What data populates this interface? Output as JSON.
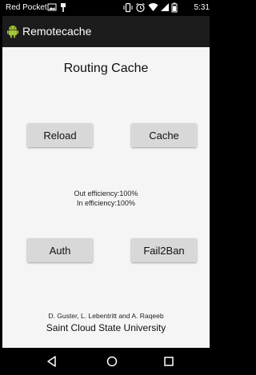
{
  "status_bar": {
    "carrier": "Red Pocket",
    "time": "5:31",
    "icons": [
      "image-icon",
      "usb-icon",
      "vibrate-icon",
      "alarm-icon",
      "wifi-icon",
      "signal-icon",
      "battery-icon"
    ]
  },
  "app_bar": {
    "title": "Remotecache",
    "icon": "android-icon"
  },
  "main": {
    "heading": "Routing Cache",
    "buttons": {
      "reload": "Reload",
      "cache": "Cache",
      "auth": "Auth",
      "fail2ban": "Fail2Ban"
    },
    "out_efficiency": "Out efficiency:100%",
    "in_efficiency": "In efficiency:100%",
    "authors": "D. Guster, L. Lebentritt and A. Raqeeb",
    "university": "Saint Cloud State University"
  },
  "nav_bar": {
    "icons": [
      "back-icon",
      "home-icon",
      "recents-icon"
    ]
  },
  "colors": {
    "app_bar_bg": "#1c1c1c",
    "content_bg": "#f5f5f5",
    "button_bg": "#d8d8d8",
    "android_green": "#a4c639"
  }
}
